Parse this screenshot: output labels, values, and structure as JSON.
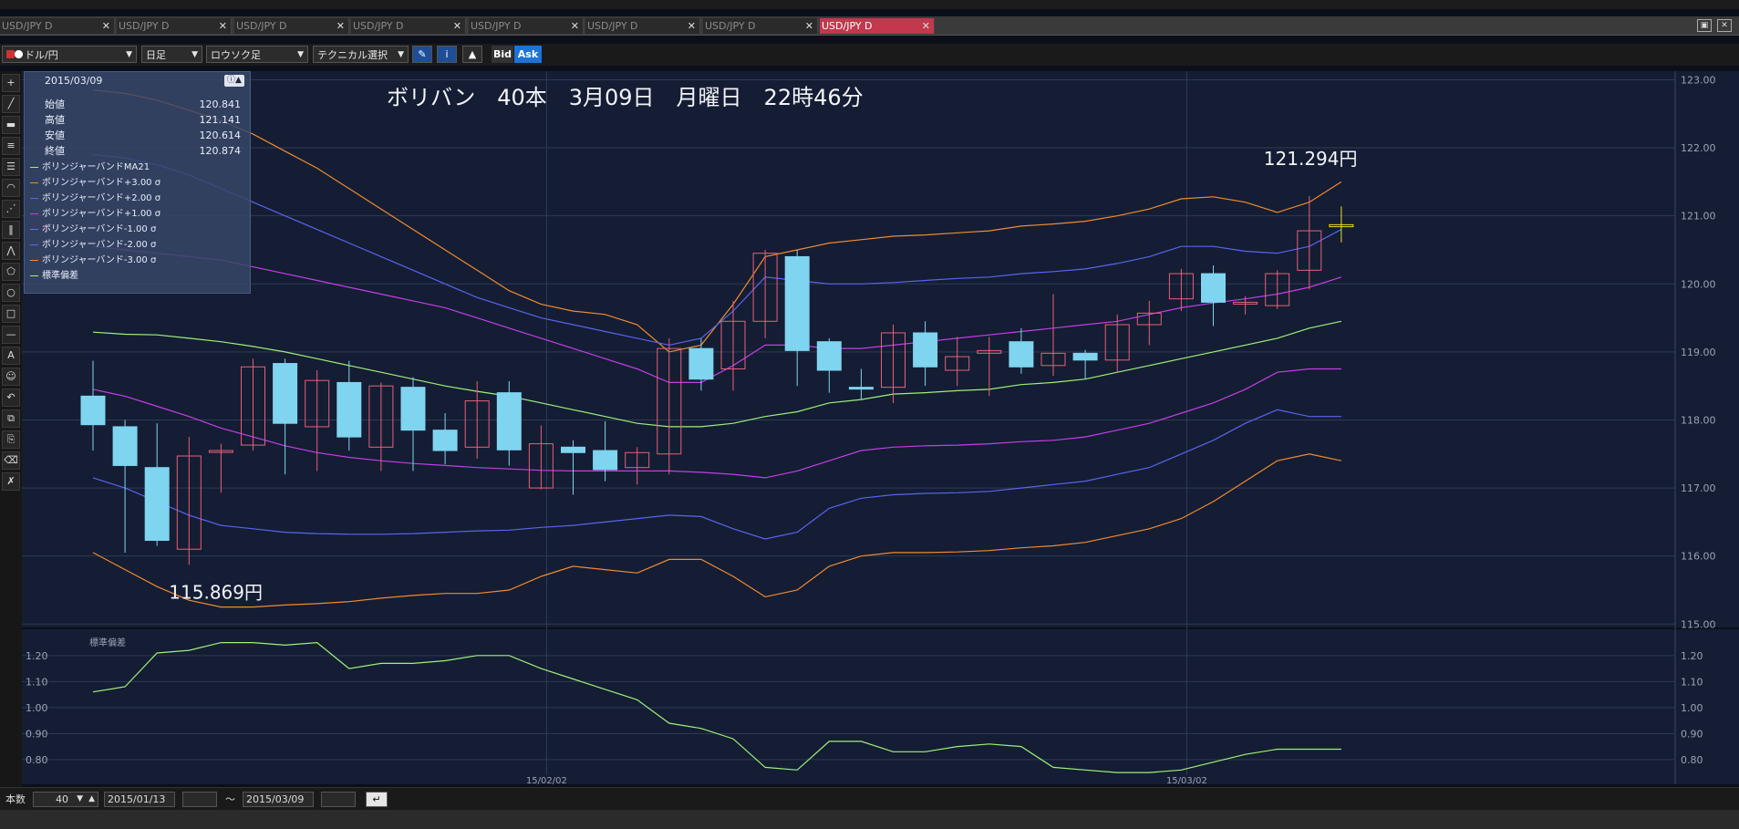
{
  "tabs": [
    {
      "label": "USD/JPY D",
      "active": false
    },
    {
      "label": "USD/JPY D",
      "active": false
    },
    {
      "label": "USD/JPY D",
      "active": false
    },
    {
      "label": "USD/JPY D",
      "active": false
    },
    {
      "label": "USD/JPY D",
      "active": false
    },
    {
      "label": "USD/JPY D",
      "active": false
    },
    {
      "label": "USD/JPY D",
      "active": false
    },
    {
      "label": "USD/JPY D",
      "active": true
    }
  ],
  "toolbar": {
    "pair": "ドル/円",
    "timeframe": "日足",
    "chart_type": "ロウソク足",
    "technical": "テクニカル選択",
    "bid": "Bid",
    "ask": "Ask"
  },
  "info": {
    "date": "2015/03/09",
    "open_label": "始値",
    "open": "120.841",
    "high_label": "高値",
    "high": "121.141",
    "low_label": "安値",
    "low": "120.614",
    "close_label": "終値",
    "close": "120.874",
    "legend": [
      {
        "label": "ボリンジャーバンドMA21",
        "color": "#9ef07a"
      },
      {
        "label": "ボリンジャーバンド+3.00 σ",
        "color": "#f08a30"
      },
      {
        "label": "ボリンジャーバンド+2.00 σ",
        "color": "#5a63f0"
      },
      {
        "label": "ボリンジャーバンド+1.00 σ",
        "color": "#c43ee8"
      },
      {
        "label": "ボリンジャーバンド-1.00 σ",
        "color": "#c43ee8"
      },
      {
        "label": "ボリンジャーバンド-2.00 σ",
        "color": "#5a63f0"
      },
      {
        "label": "ボリンジャーバンド-3.00 σ",
        "color": "#f08a30"
      },
      {
        "label": "標準偏差",
        "color": "#9ef07a"
      }
    ]
  },
  "bottom": {
    "count_label": "本数",
    "count": "40",
    "start_date": "2015/01/13",
    "tilde": "～",
    "end_date": "2015/03/09"
  },
  "colors": {
    "background": "#141d33",
    "grid": "#2f3a55",
    "up_candle": "#e8607a",
    "down_candle": "#7fd4f0",
    "ma": "#9ef07a",
    "sigma3": "#f08a30",
    "sigma2": "#5a63f0",
    "sigma1": "#c43ee8",
    "stddev": "#9ef07a"
  },
  "chart_data": {
    "type": "candlestick",
    "title": "ボリバン　40本　3月09日　月曜日　22時46分",
    "annotations": {
      "high": "121.294円",
      "low": "115.869円"
    },
    "price_axis": {
      "ylim": [
        114.95,
        123.1
      ],
      "ticks": [
        "123.00",
        "122.00",
        "121.00",
        "120.00",
        "119.00",
        "118.00",
        "117.00",
        "116.00",
        "115.00"
      ]
    },
    "x_tick_labels": [
      {
        "label": "15/02/02",
        "index": 14
      },
      {
        "label": "15/03/02",
        "index": 34
      }
    ],
    "candles": [
      {
        "o": 118.35,
        "h": 118.87,
        "l": 117.55,
        "c": 117.93
      },
      {
        "o": 117.9,
        "h": 118.0,
        "l": 116.05,
        "c": 117.33
      },
      {
        "o": 117.3,
        "h": 117.95,
        "l": 116.15,
        "c": 116.23
      },
      {
        "o": 116.1,
        "h": 117.75,
        "l": 115.87,
        "c": 117.47
      },
      {
        "o": 117.53,
        "h": 117.65,
        "l": 116.93,
        "c": 117.55
      },
      {
        "o": 117.63,
        "h": 118.9,
        "l": 117.55,
        "c": 118.78
      },
      {
        "o": 118.83,
        "h": 118.9,
        "l": 117.2,
        "c": 117.95
      },
      {
        "o": 117.9,
        "h": 118.73,
        "l": 117.25,
        "c": 118.58
      },
      {
        "o": 118.55,
        "h": 118.87,
        "l": 117.55,
        "c": 117.75
      },
      {
        "o": 117.6,
        "h": 118.55,
        "l": 117.25,
        "c": 118.5
      },
      {
        "o": 118.48,
        "h": 118.63,
        "l": 117.25,
        "c": 117.85
      },
      {
        "o": 117.85,
        "h": 118.1,
        "l": 117.35,
        "c": 117.55
      },
      {
        "o": 117.6,
        "h": 118.57,
        "l": 117.43,
        "c": 118.28
      },
      {
        "o": 118.4,
        "h": 118.57,
        "l": 117.33,
        "c": 117.56
      },
      {
        "o": 117.0,
        "h": 117.92,
        "l": 116.98,
        "c": 117.65
      },
      {
        "o": 117.6,
        "h": 117.7,
        "l": 116.9,
        "c": 117.52
      },
      {
        "o": 117.55,
        "h": 117.98,
        "l": 117.1,
        "c": 117.27
      },
      {
        "o": 117.3,
        "h": 117.6,
        "l": 117.05,
        "c": 117.52
      },
      {
        "o": 117.5,
        "h": 119.2,
        "l": 117.2,
        "c": 119.05
      },
      {
        "o": 119.05,
        "h": 119.2,
        "l": 118.43,
        "c": 118.6
      },
      {
        "o": 118.75,
        "h": 119.75,
        "l": 118.43,
        "c": 119.45
      },
      {
        "o": 119.45,
        "h": 120.5,
        "l": 119.2,
        "c": 120.45
      },
      {
        "o": 120.4,
        "h": 120.5,
        "l": 118.5,
        "c": 119.02
      },
      {
        "o": 119.15,
        "h": 119.2,
        "l": 118.4,
        "c": 118.73
      },
      {
        "o": 118.48,
        "h": 118.75,
        "l": 118.3,
        "c": 118.47
      },
      {
        "o": 118.48,
        "h": 119.4,
        "l": 118.25,
        "c": 119.28
      },
      {
        "o": 119.28,
        "h": 119.45,
        "l": 118.5,
        "c": 118.78
      },
      {
        "o": 118.73,
        "h": 119.22,
        "l": 118.5,
        "c": 118.93
      },
      {
        "o": 118.98,
        "h": 119.22,
        "l": 118.35,
        "c": 119.02
      },
      {
        "o": 119.15,
        "h": 119.35,
        "l": 118.68,
        "c": 118.78
      },
      {
        "o": 118.8,
        "h": 119.85,
        "l": 118.65,
        "c": 118.98
      },
      {
        "o": 118.98,
        "h": 119.03,
        "l": 118.6,
        "c": 118.88
      },
      {
        "o": 118.88,
        "h": 119.55,
        "l": 118.7,
        "c": 119.4
      },
      {
        "o": 119.4,
        "h": 119.75,
        "l": 119.1,
        "c": 119.57
      },
      {
        "o": 119.78,
        "h": 120.22,
        "l": 119.6,
        "c": 120.15
      },
      {
        "o": 120.15,
        "h": 120.27,
        "l": 119.38,
        "c": 119.73
      },
      {
        "o": 119.73,
        "h": 119.82,
        "l": 119.55,
        "c": 119.73
      },
      {
        "o": 119.68,
        "h": 120.2,
        "l": 119.63,
        "c": 120.15
      },
      {
        "o": 120.2,
        "h": 121.29,
        "l": 119.92,
        "c": 120.78
      },
      {
        "o": 120.84,
        "h": 121.14,
        "l": 120.61,
        "c": 120.87
      }
    ],
    "bollinger": {
      "ma21": [
        119.29,
        119.26,
        119.25,
        119.2,
        119.15,
        119.08,
        119.0,
        118.9,
        118.8,
        118.7,
        118.6,
        118.5,
        118.42,
        118.35,
        118.25,
        118.15,
        118.05,
        117.95,
        117.9,
        117.9,
        117.95,
        118.05,
        118.12,
        118.25,
        118.3,
        118.38,
        118.4,
        118.43,
        118.45,
        118.52,
        118.55,
        118.6,
        118.7,
        118.8,
        118.9,
        119.0,
        119.1,
        119.2,
        119.35,
        119.45
      ],
      "p3": [
        122.85,
        122.8,
        122.7,
        122.55,
        122.4,
        122.2,
        121.95,
        121.7,
        121.4,
        121.1,
        120.8,
        120.5,
        120.2,
        119.9,
        119.7,
        119.6,
        119.55,
        119.4,
        119.0,
        119.1,
        119.7,
        120.4,
        120.5,
        120.6,
        120.65,
        120.7,
        120.72,
        120.75,
        120.78,
        120.85,
        120.88,
        120.92,
        121.0,
        121.1,
        121.25,
        121.28,
        121.2,
        121.05,
        121.2,
        121.5
      ],
      "p2": [
        121.9,
        121.85,
        121.75,
        121.6,
        121.4,
        121.2,
        121.0,
        120.8,
        120.6,
        120.4,
        120.2,
        120.0,
        119.8,
        119.65,
        119.5,
        119.4,
        119.3,
        119.2,
        119.1,
        119.2,
        119.6,
        120.1,
        120.05,
        120.0,
        120.0,
        120.02,
        120.05,
        120.08,
        120.1,
        120.15,
        120.18,
        120.22,
        120.3,
        120.4,
        120.55,
        120.55,
        120.48,
        120.45,
        120.55,
        120.8
      ],
      "p1": [
        120.55,
        120.5,
        120.45,
        120.4,
        120.35,
        120.25,
        120.15,
        120.05,
        119.95,
        119.85,
        119.75,
        119.65,
        119.5,
        119.35,
        119.2,
        119.05,
        118.9,
        118.75,
        118.55,
        118.55,
        118.8,
        119.1,
        119.1,
        119.05,
        119.05,
        119.1,
        119.15,
        119.2,
        119.25,
        119.3,
        119.35,
        119.4,
        119.45,
        119.55,
        119.65,
        119.72,
        119.78,
        119.85,
        119.95,
        120.1
      ],
      "m1": [
        118.45,
        118.35,
        118.2,
        118.05,
        117.88,
        117.75,
        117.62,
        117.52,
        117.45,
        117.4,
        117.36,
        117.33,
        117.3,
        117.28,
        117.26,
        117.25,
        117.25,
        117.25,
        117.25,
        117.23,
        117.2,
        117.15,
        117.25,
        117.4,
        117.55,
        117.6,
        117.62,
        117.63,
        117.65,
        117.68,
        117.7,
        117.75,
        117.85,
        117.95,
        118.1,
        118.25,
        118.45,
        118.7,
        118.75,
        118.75
      ],
      "m2": [
        117.15,
        117.0,
        116.8,
        116.6,
        116.45,
        116.4,
        116.35,
        116.33,
        116.32,
        116.32,
        116.33,
        116.35,
        116.37,
        116.38,
        116.42,
        116.45,
        116.5,
        116.55,
        116.6,
        116.58,
        116.4,
        116.25,
        116.35,
        116.7,
        116.85,
        116.9,
        116.92,
        116.93,
        116.95,
        117.0,
        117.05,
        117.1,
        117.2,
        117.3,
        117.5,
        117.7,
        117.95,
        118.15,
        118.05,
        118.05
      ],
      "m3": [
        116.05,
        115.8,
        115.55,
        115.35,
        115.25,
        115.25,
        115.28,
        115.3,
        115.33,
        115.38,
        115.42,
        115.45,
        115.45,
        115.5,
        115.7,
        115.85,
        115.8,
        115.75,
        115.95,
        115.95,
        115.7,
        115.4,
        115.5,
        115.85,
        116.0,
        116.05,
        116.05,
        116.06,
        116.08,
        116.12,
        116.15,
        116.2,
        116.3,
        116.4,
        116.55,
        116.8,
        117.1,
        117.4,
        117.5,
        117.4
      ]
    },
    "stddev": {
      "label": "標準偏差",
      "ylim": [
        0.74,
        1.28
      ],
      "ticks": [
        "1.20",
        "1.10",
        "1.00",
        "0.90",
        "0.80"
      ],
      "values": [
        1.06,
        1.08,
        1.21,
        1.22,
        1.25,
        1.25,
        1.24,
        1.25,
        1.15,
        1.17,
        1.17,
        1.18,
        1.2,
        1.2,
        1.15,
        1.11,
        1.07,
        1.03,
        0.94,
        0.92,
        0.88,
        0.77,
        0.76,
        0.87,
        0.87,
        0.83,
        0.83,
        0.85,
        0.86,
        0.85,
        0.77,
        0.76,
        0.75,
        0.75,
        0.76,
        0.79,
        0.82,
        0.84,
        0.84,
        0.84
      ]
    }
  }
}
